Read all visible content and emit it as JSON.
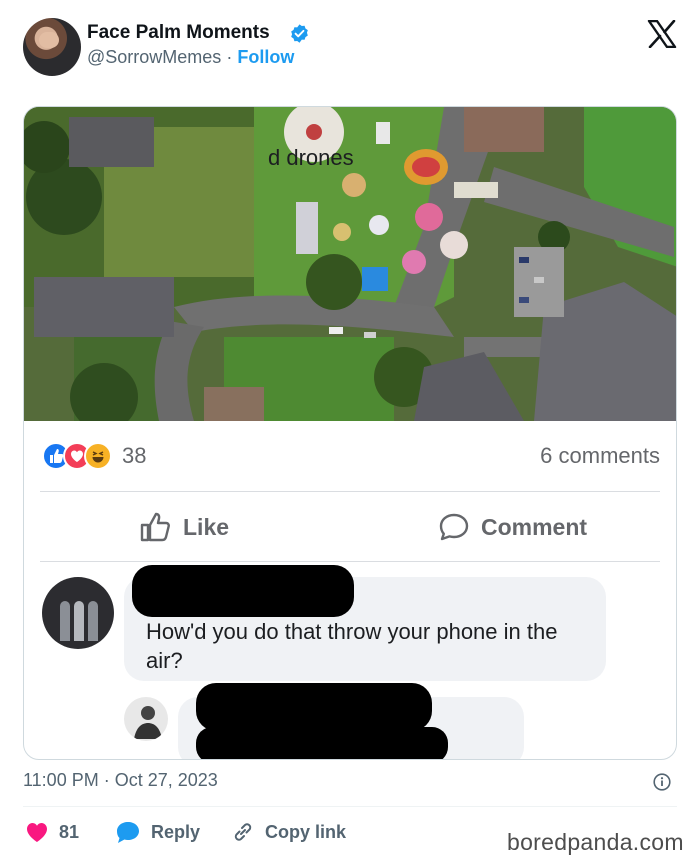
{
  "tweet": {
    "author_name": "Face Palm Moments",
    "handle": "@SorrowMemes",
    "separator": "·",
    "follow_label": "Follow",
    "verified_icon": "verified-badge-icon",
    "brand_icon": "x-logo-icon",
    "accent_color": "#1d9bf0"
  },
  "post": {
    "reactions_count": "38",
    "comments_count": "6 comments",
    "like_label": "Like",
    "comment_label": "Comment",
    "comment": {
      "text": "How'd you do that throw your phone in the air?"
    },
    "reply": {
      "visible_text": "d drones"
    }
  },
  "footer": {
    "time": "11:00 PM",
    "separator": "·",
    "date": "Oct 27, 2023",
    "likes": "81",
    "reply_label": "Reply",
    "copy_link_label": "Copy link",
    "like_color": "#f91880"
  },
  "watermark": "boredpanda.com"
}
